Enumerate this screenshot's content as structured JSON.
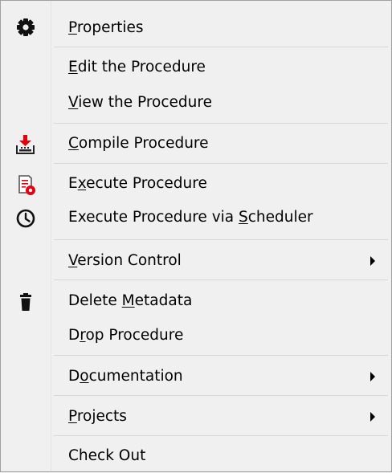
{
  "menu": {
    "items": [
      {
        "id": "properties",
        "pre": "",
        "acc": "P",
        "post": "roperties",
        "icon": "gear-icon",
        "submenu": false
      },
      {
        "id": "edit-procedure",
        "pre": "",
        "acc": "E",
        "post": "dit the Procedure",
        "icon": "",
        "submenu": false
      },
      {
        "id": "view-procedure",
        "pre": "",
        "acc": "V",
        "post": "iew the Procedure",
        "icon": "",
        "submenu": false
      },
      {
        "id": "compile-procedure",
        "pre": "",
        "acc": "C",
        "post": "ompile Procedure",
        "icon": "compile-icon",
        "submenu": false
      },
      {
        "id": "execute-procedure",
        "pre": "E",
        "acc": "x",
        "post": "ecute Procedure",
        "icon": "execute-icon",
        "submenu": false
      },
      {
        "id": "execute-via-scheduler",
        "pre": "Execute Procedure via ",
        "acc": "S",
        "post": "cheduler",
        "icon": "clock-icon",
        "submenu": false
      },
      {
        "id": "version-control",
        "pre": "",
        "acc": "V",
        "post": "ersion Control",
        "icon": "",
        "submenu": true
      },
      {
        "id": "delete-metadata",
        "pre": "Delete ",
        "acc": "M",
        "post": "etadata",
        "icon": "trash-icon",
        "submenu": false
      },
      {
        "id": "drop-procedure",
        "pre": "D",
        "acc": "r",
        "post": "op Procedure",
        "icon": "",
        "submenu": false
      },
      {
        "id": "documentation",
        "pre": "D",
        "acc": "o",
        "post": "cumentation",
        "icon": "",
        "submenu": true
      },
      {
        "id": "projects",
        "pre": "",
        "acc": "P",
        "post": "rojects",
        "icon": "",
        "submenu": true
      },
      {
        "id": "check-out",
        "pre": "Check Out",
        "acc": "",
        "post": "",
        "icon": "",
        "submenu": false
      }
    ],
    "colors": {
      "background": "#f0f0f0",
      "border": "#a0a0a0",
      "separator": "#d7d7d7",
      "accent_red": "#e8000f"
    }
  }
}
